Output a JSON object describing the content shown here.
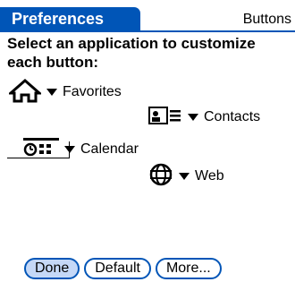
{
  "window": {
    "title": "Preferences",
    "section": "Buttons"
  },
  "instruction": "Select an application to customize each button:",
  "assignments": [
    {
      "button_icon": "home-icon",
      "application": "Favorites"
    },
    {
      "button_icon": "contacts-icon",
      "application": "Contacts"
    },
    {
      "button_icon": "calendar-icon",
      "application": "Calendar"
    },
    {
      "button_icon": "globe-icon",
      "application": "Web"
    }
  ],
  "buttons": {
    "done": "Done",
    "default": "Default",
    "more": "More..."
  },
  "colors": {
    "accent": "#0055b7",
    "done_fill": "#c5d8f7"
  }
}
